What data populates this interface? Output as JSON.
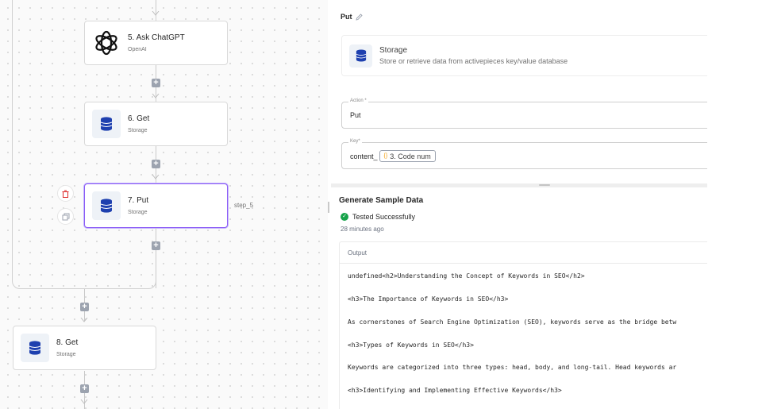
{
  "flow": {
    "nodes": [
      {
        "title": "5. Ask ChatGPT",
        "subtitle": "OpenAI",
        "icon": "openai-icon"
      },
      {
        "title": "6. Get",
        "subtitle": "Storage",
        "icon": "storage-icon"
      },
      {
        "title": "7. Put",
        "subtitle": "Storage",
        "icon": "storage-icon"
      },
      {
        "title": "8. Get",
        "subtitle": "Storage",
        "icon": "storage-icon"
      }
    ],
    "selected_step_label": "step_5"
  },
  "panel": {
    "title": "Put",
    "piece": {
      "name": "Storage",
      "description": "Store or retrieve data from activepieces key/value database"
    },
    "action_field": {
      "label": "Action *",
      "value": "Put"
    },
    "key_field": {
      "label": "Key*",
      "prefix": "content_",
      "chip_icon": "{}",
      "chip_label": "3. Code num"
    },
    "sample": {
      "title": "Generate Sample Data",
      "status": "Tested Successfully",
      "time_ago": "28 minutes ago",
      "output_label": "Output",
      "lines": [
        "undefined<h2>Understanding the Concept of Keywords in SEO</h2>",
        "<h3>The Importance of Keywords in SEO</h3>",
        "As cornerstones of Search Engine Optimization (SEO), keywords serve as the bridge betw",
        "<h3>Types of Keywords in SEO</h3>",
        "Keywords are categorized into three types: head, body, and long-tail. Head keywords ar",
        "<h3>Identifying and Implementing Effective Keywords</h3>"
      ]
    }
  },
  "colors": {
    "selected_border": "#8b5cf6",
    "storage_blue": "#1e40af",
    "success": "#16a34a",
    "delete_red": "#dc2626"
  }
}
